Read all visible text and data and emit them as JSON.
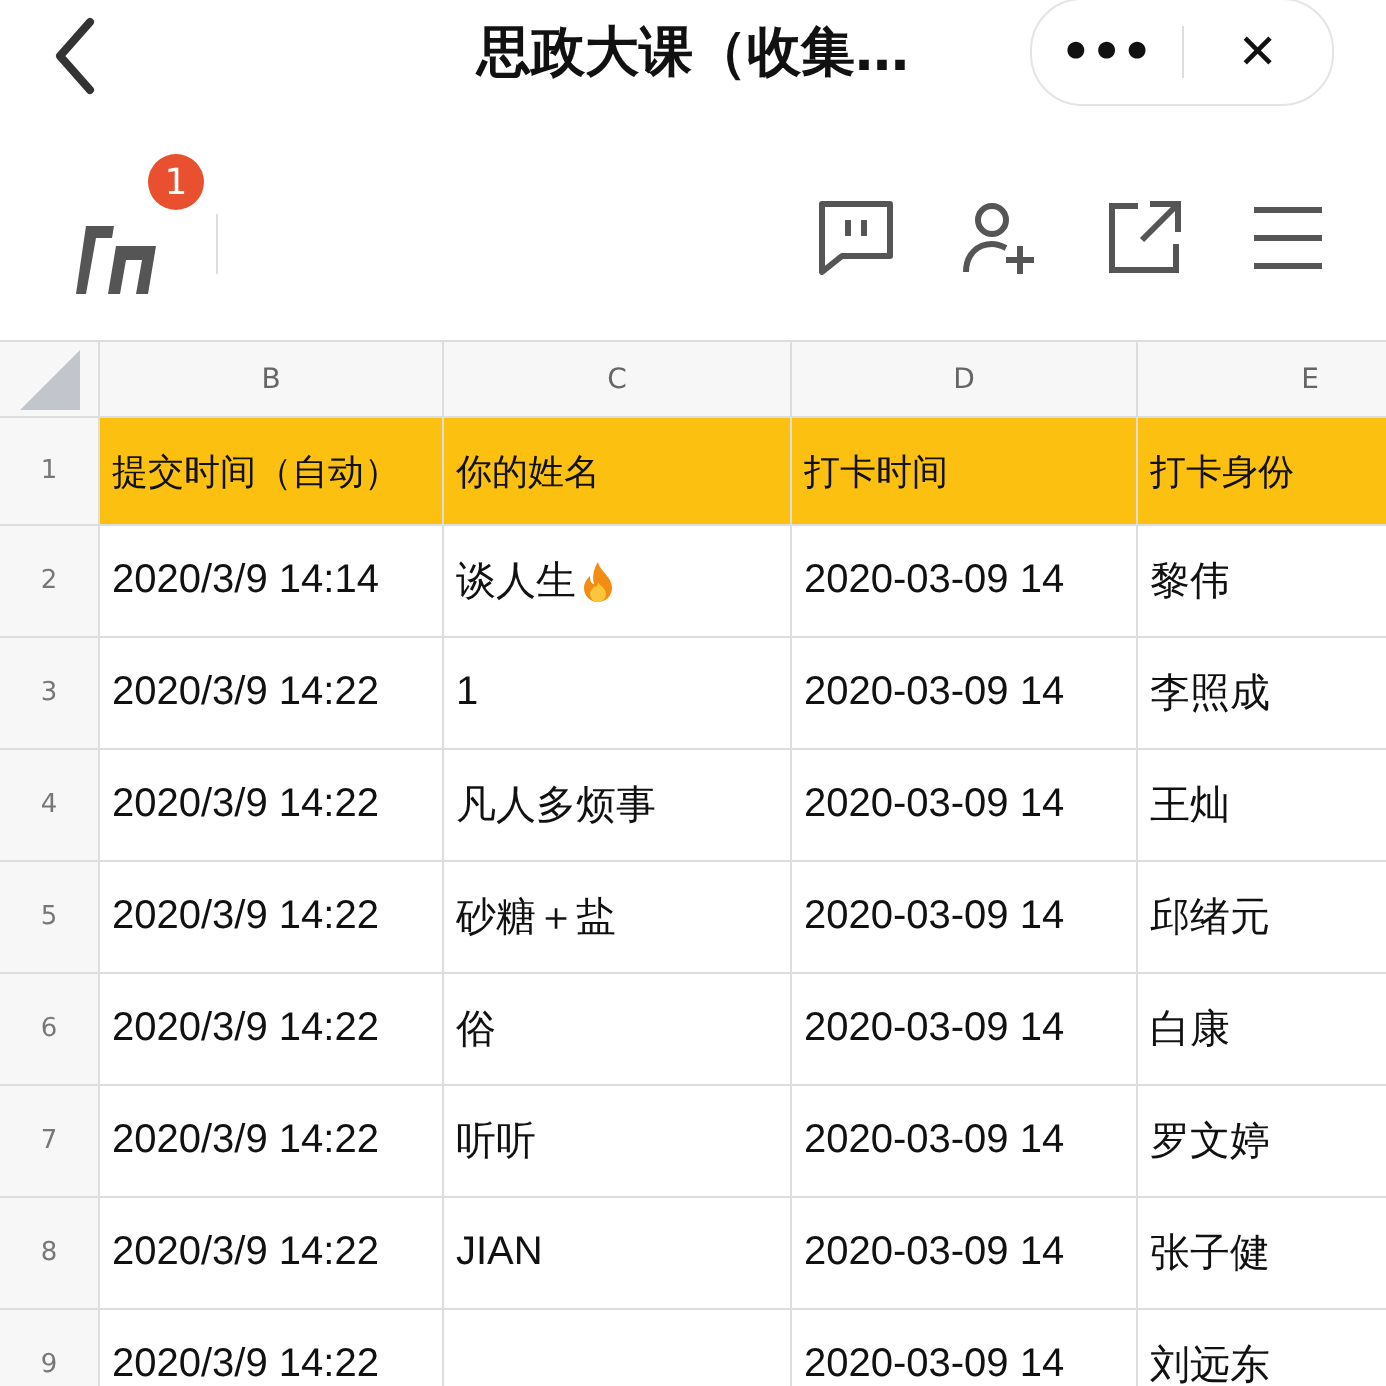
{
  "nav": {
    "title": "思政大课（收集…",
    "more": "•••",
    "close": "✕"
  },
  "toolbar": {
    "badge": "1"
  },
  "sheet": {
    "columns": [
      "B",
      "C",
      "D",
      "E"
    ],
    "rows": [
      {
        "num": "1",
        "kind": "header",
        "cells": [
          "提交时间（自动）",
          "你的姓名",
          "打卡时间",
          "打卡身份"
        ]
      },
      {
        "num": "2",
        "kind": "flame",
        "cells": [
          "2020/3/9 14:14",
          "谈人生",
          "2020-03-09 14",
          "黎伟"
        ]
      },
      {
        "num": "3",
        "kind": "data",
        "cells": [
          "2020/3/9 14:22",
          "1",
          "2020-03-09 14",
          "李照成"
        ]
      },
      {
        "num": "4",
        "kind": "data",
        "cells": [
          "2020/3/9 14:22",
          "凡人多烦事",
          "2020-03-09 14",
          "王灿"
        ]
      },
      {
        "num": "5",
        "kind": "data",
        "cells": [
          "2020/3/9 14:22",
          "砂糖＋盐",
          "2020-03-09 14",
          "邱绪元"
        ]
      },
      {
        "num": "6",
        "kind": "data",
        "cells": [
          "2020/3/9 14:22",
          "俗",
          "2020-03-09 14",
          "白康"
        ]
      },
      {
        "num": "7",
        "kind": "data",
        "cells": [
          "2020/3/9 14:22",
          "听听",
          "2020-03-09 14",
          "罗文婷"
        ]
      },
      {
        "num": "8",
        "kind": "data",
        "cells": [
          "2020/3/9 14:22",
          "JIAN",
          "2020-03-09 14",
          "张子健"
        ]
      },
      {
        "num": "9",
        "kind": "data",
        "cells": [
          "2020/3/9 14:22",
          null,
          "2020-03-09 14",
          "刘远东"
        ]
      }
    ]
  }
}
